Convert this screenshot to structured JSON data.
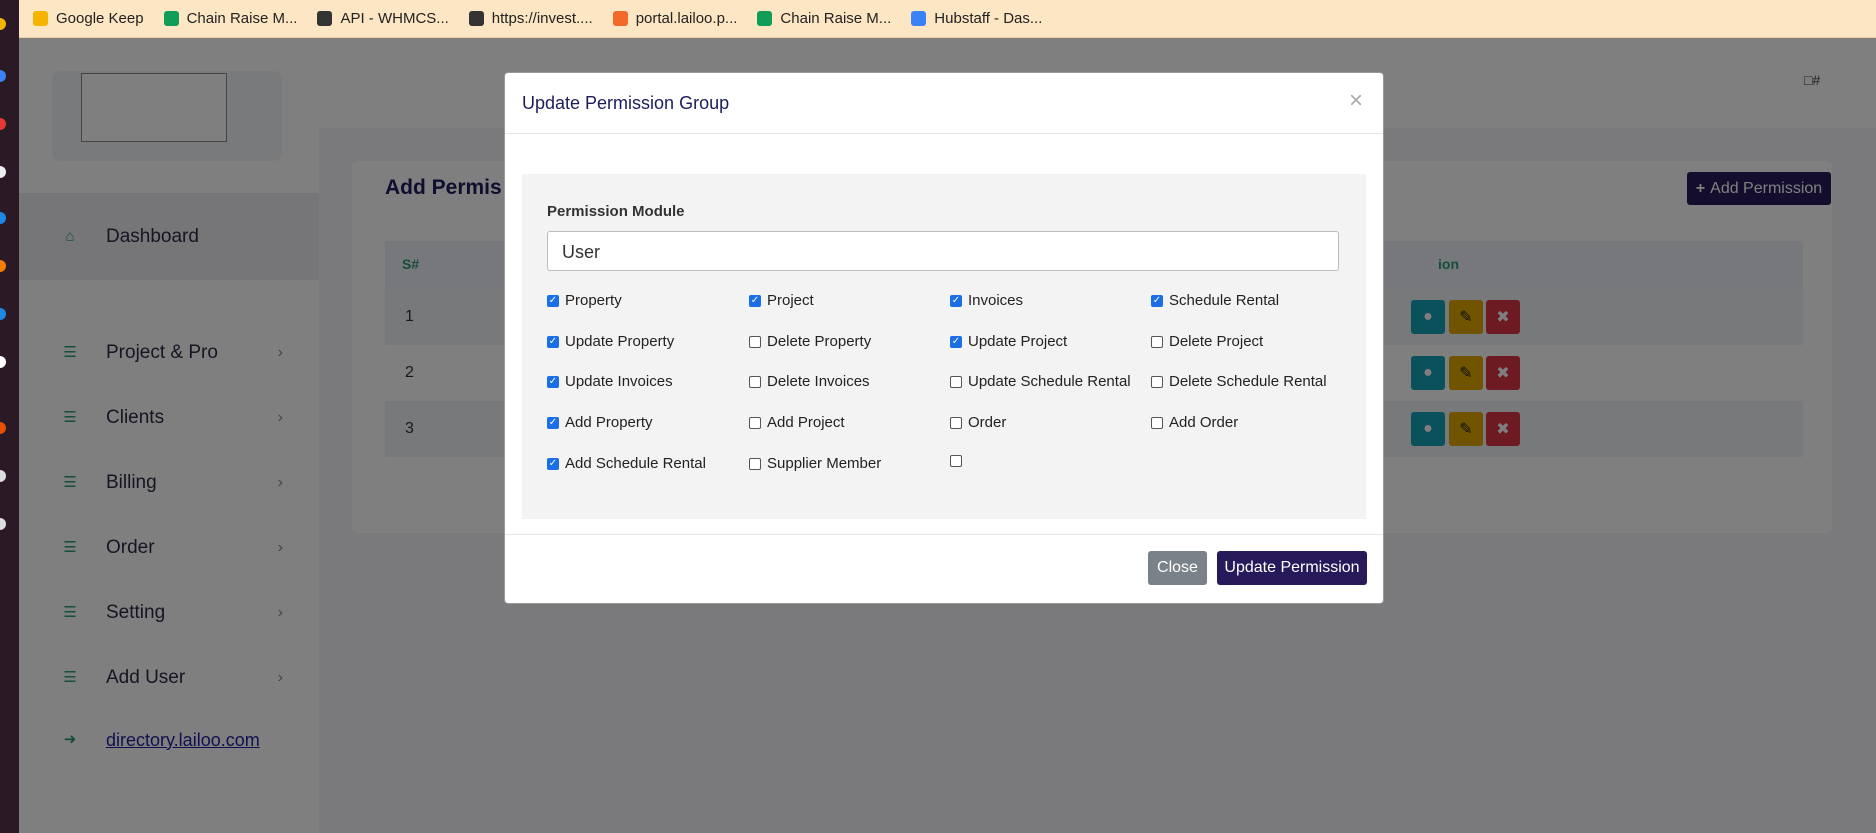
{
  "bookmarks": [
    {
      "label": "Google Keep",
      "icon": "google-keep-icon",
      "color": "#f4b400"
    },
    {
      "label": "Chain Raise M...",
      "icon": "google-sheets-icon",
      "color": "#0f9d58"
    },
    {
      "label": "API - WHMCS...",
      "icon": "globe-icon",
      "color": "#333333"
    },
    {
      "label": "https://invest....",
      "icon": "globe-icon",
      "color": "#333333"
    },
    {
      "label": "portal.lailoo.p...",
      "icon": "lailoo-icon",
      "color": "#f26a2a"
    },
    {
      "label": "Chain Raise M...",
      "icon": "google-sheets-icon",
      "color": "#0f9d58"
    },
    {
      "label": "Hubstaff - Das...",
      "icon": "hubstaff-icon",
      "color": "#3b82f6"
    }
  ],
  "sidebar": {
    "items": [
      {
        "label": "Dashboard",
        "icon": "home-icon",
        "chevron": false
      },
      {
        "label": "Project & Pro",
        "icon": "list-icon",
        "chevron": true
      },
      {
        "label": "Clients",
        "icon": "list-icon",
        "chevron": true
      },
      {
        "label": "Billing",
        "icon": "list-icon",
        "chevron": true
      },
      {
        "label": "Order",
        "icon": "list-icon",
        "chevron": true
      },
      {
        "label": "Setting",
        "icon": "list-icon",
        "chevron": true
      },
      {
        "label": "Add User",
        "icon": "list-icon",
        "chevron": true
      }
    ],
    "logout_link": "directory.lailoo.com"
  },
  "main": {
    "avatar_alt": "#",
    "card_title": "Add Permis",
    "add_button": "Add Permission",
    "table": {
      "headers": [
        "S#",
        "ion"
      ],
      "rows": [
        "1",
        "2",
        "3"
      ]
    }
  },
  "modal": {
    "title": "Update Permission Group",
    "close_symbol": "×",
    "module_label": "Permission Module",
    "module_value": "User",
    "permissions": [
      {
        "label": "Property",
        "checked": true
      },
      {
        "label": "Project",
        "checked": true
      },
      {
        "label": "Invoices",
        "checked": true
      },
      {
        "label": "Schedule Rental",
        "checked": true
      },
      {
        "label": "Update Property",
        "checked": true
      },
      {
        "label": "Delete Property",
        "checked": false
      },
      {
        "label": "Update Project",
        "checked": true
      },
      {
        "label": "Delete Project",
        "checked": false
      },
      {
        "label": "Update Invoices",
        "checked": true
      },
      {
        "label": "Delete Invoices",
        "checked": false
      },
      {
        "label": "Update Schedule Rental",
        "checked": false
      },
      {
        "label": "Delete Schedule Rental",
        "checked": false
      },
      {
        "label": "Add Property",
        "checked": true
      },
      {
        "label": "Add Project",
        "checked": false
      },
      {
        "label": "Order",
        "checked": false
      },
      {
        "label": "Add Order",
        "checked": false
      },
      {
        "label": "Add Schedule Rental",
        "checked": true
      },
      {
        "label": "Supplier Member",
        "checked": false
      },
      {
        "label": "",
        "checked": false
      }
    ],
    "close_button": "Close",
    "update_button": "Update Permission"
  },
  "colors": {
    "accent": "#281a5a",
    "teal": "#2a9d7a",
    "info": "#17a2b8",
    "warning": "#e0a800",
    "danger": "#dc3545"
  }
}
